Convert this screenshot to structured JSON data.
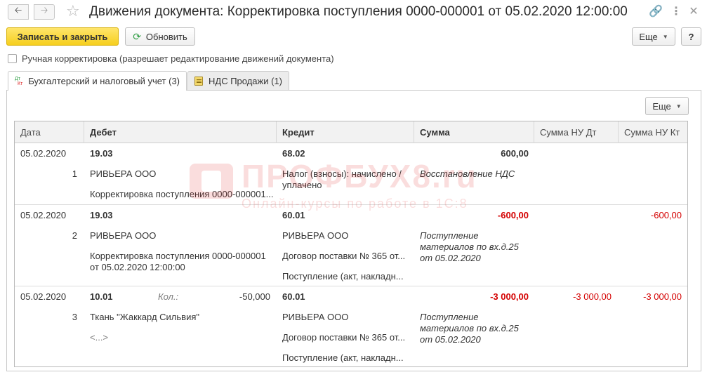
{
  "window": {
    "title": "Движения документа: Корректировка поступления 0000-000001 от 05.02.2020 12:00:00",
    "back_icon": "arrow-left",
    "forward_icon": "arrow-right",
    "favorite_icon": "star",
    "link_icon": "link",
    "menu_icon": "kebab",
    "close_icon": "close"
  },
  "toolbar": {
    "save_close_label": "Записать и закрыть",
    "refresh_label": "Обновить",
    "more_label": "Еще",
    "help_label": "?"
  },
  "manual_correction": {
    "label": "Ручная корректировка (разрешает редактирование движений документа)",
    "checked": false
  },
  "tabs": [
    {
      "label": "Бухгалтерский и налоговый учет (3)",
      "icon": "dt-kt",
      "active": true
    },
    {
      "label": "НДС Продажи (1)",
      "icon": "register",
      "active": false
    }
  ],
  "grid": {
    "more_label": "Еще",
    "columns": [
      "Дата",
      "Дебет",
      "Кредит",
      "Сумма",
      "Сумма НУ Дт",
      "Сумма НУ Кт"
    ],
    "rows": [
      {
        "date": "05.02.2020",
        "num": "1",
        "debit_account": "19.03",
        "debit_sub1": "РИВЬЕРА ООО",
        "debit_sub2": "Корректировка поступления 0000-000001...",
        "qty_label": "",
        "qty": "",
        "credit_account": "68.02",
        "credit_sub1": "Налог (взносы): начислено / уплачено",
        "credit_sub2": "",
        "credit_sub3": "",
        "sum": "600,00",
        "content": "Восстановление НДС",
        "sum_nu_dt": "",
        "sum_nu_kt": ""
      },
      {
        "date": "05.02.2020",
        "num": "2",
        "debit_account": "19.03",
        "debit_sub1": "РИВЬЕРА ООО",
        "debit_sub2": "Корректировка поступления 0000-000001 от 05.02.2020 12:00:00",
        "qty_label": "",
        "qty": "",
        "credit_account": "60.01",
        "credit_sub1": "РИВЬЕРА ООО",
        "credit_sub2": "Договор поставки № 365 от...",
        "credit_sub3": "Поступление (акт, накладн...",
        "sum": "-600,00",
        "content": "Поступление материалов по вх.д.25 от 05.02.2020",
        "sum_nu_dt": "",
        "sum_nu_kt": "-600,00"
      },
      {
        "date": "05.02.2020",
        "num": "3",
        "debit_account": "10.01",
        "debit_sub1": "Ткань \"Жаккард Сильвия\"",
        "debit_sub2": "<...>",
        "qty_label": "Кол.:",
        "qty": "-50,000",
        "credit_account": "60.01",
        "credit_sub1": "РИВЬЕРА ООО",
        "credit_sub2": "Договор поставки № 365 от...",
        "credit_sub3": "Поступление (акт, накладн...",
        "sum": "-3 000,00",
        "content": "Поступление материалов по вх.д.25 от 05.02.2020",
        "sum_nu_dt": "-3 000,00",
        "sum_nu_kt": "-3 000,00"
      }
    ]
  },
  "watermark": {
    "text": "ПРОФБУХ8.ru",
    "subtext": "Онлайн-курсы по работе в 1С:8"
  }
}
